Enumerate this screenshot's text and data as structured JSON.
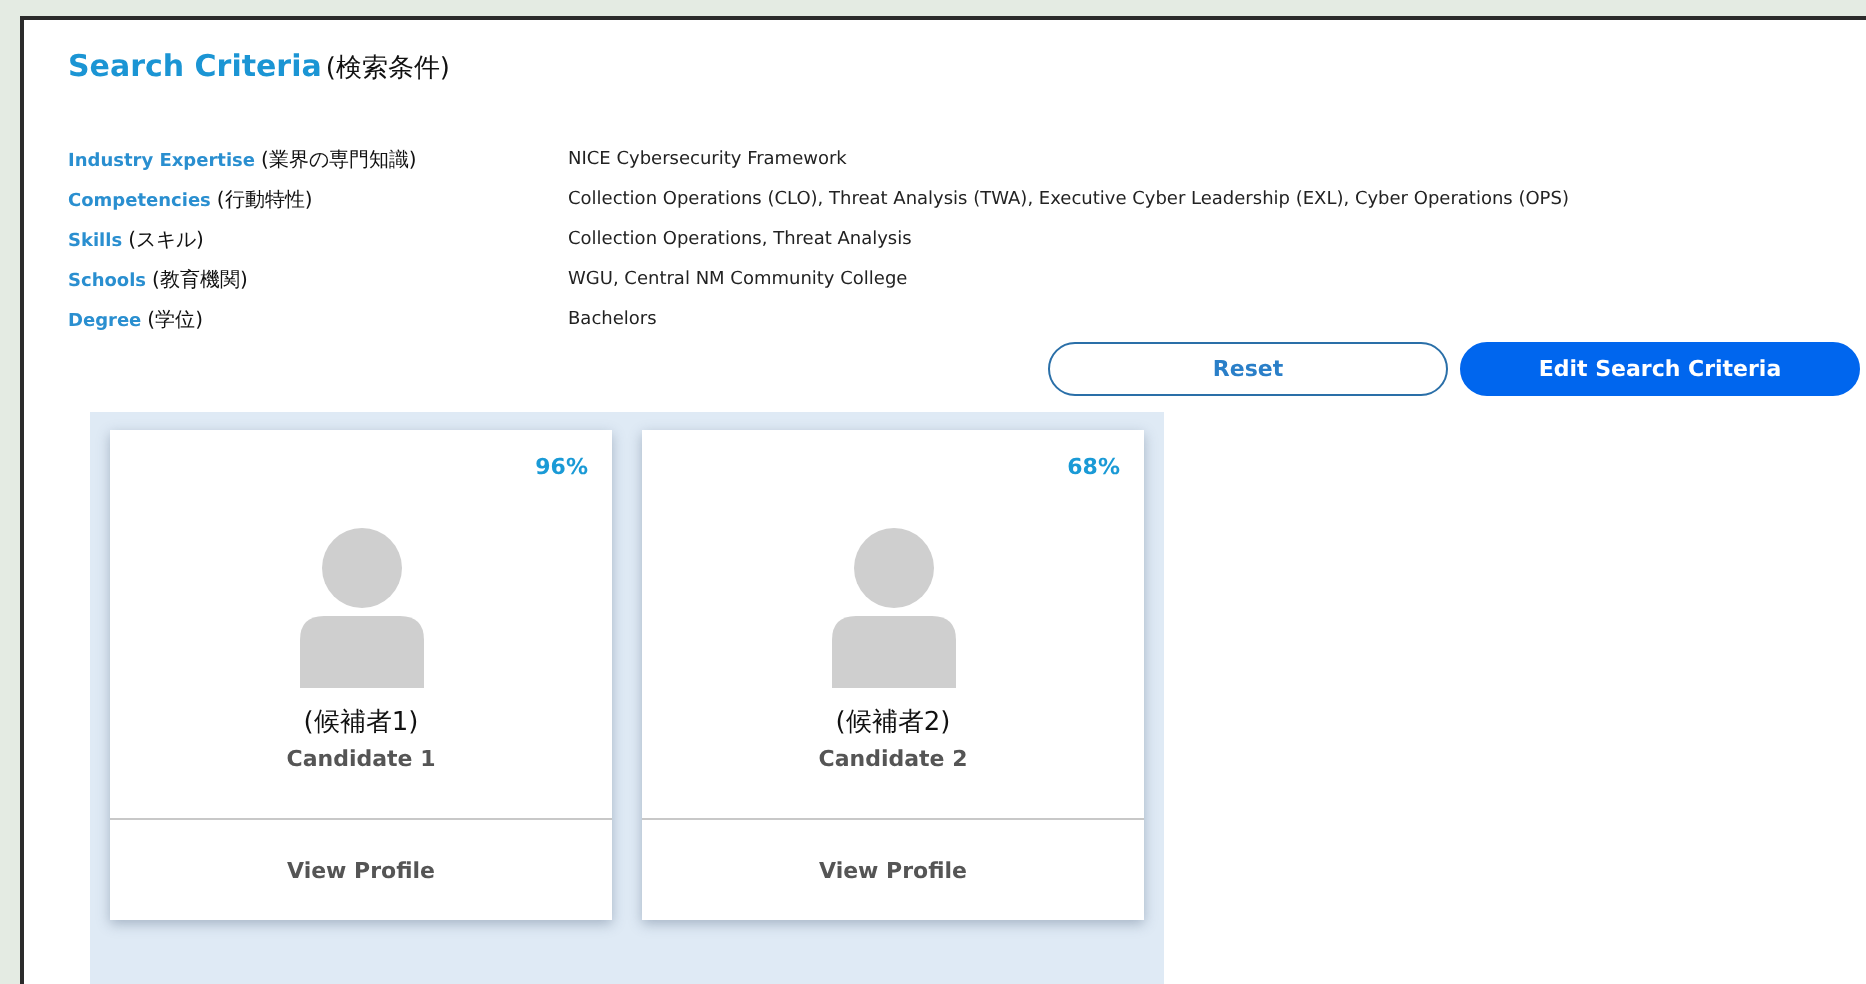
{
  "title": {
    "main": "Search Criteria",
    "note": "(検索条件)"
  },
  "criteria": [
    {
      "label": "Industry Expertise",
      "note": "(業界の専門知識)",
      "value": "NICE Cybersecurity Framework"
    },
    {
      "label": "Competencies",
      "note": "(行動特性)",
      "value": "Collection Operations (CLO), Threat Analysis (TWA), Executive Cyber Leadership (EXL), Cyber Operations (OPS)"
    },
    {
      "label": "Skills",
      "note": "(スキル)",
      "value": "Collection Operations, Threat Analysis"
    },
    {
      "label": "Schools",
      "note": "(教育機関)",
      "value": "WGU, Central NM Community College"
    },
    {
      "label": "Degree",
      "note": "(学位)",
      "value": "Bachelors"
    }
  ],
  "buttons": [
    {
      "label": "Reset",
      "kind": "outline"
    },
    {
      "label": "Edit Search Criteria",
      "kind": "primary"
    }
  ],
  "candidates": [
    {
      "match": "96%",
      "note": "(候補者1)",
      "name": "Candidate 1",
      "action": "View Profile"
    },
    {
      "match": "68%",
      "note": "(候補者2)",
      "name": "Candidate 2",
      "action": "View Profile"
    }
  ]
}
